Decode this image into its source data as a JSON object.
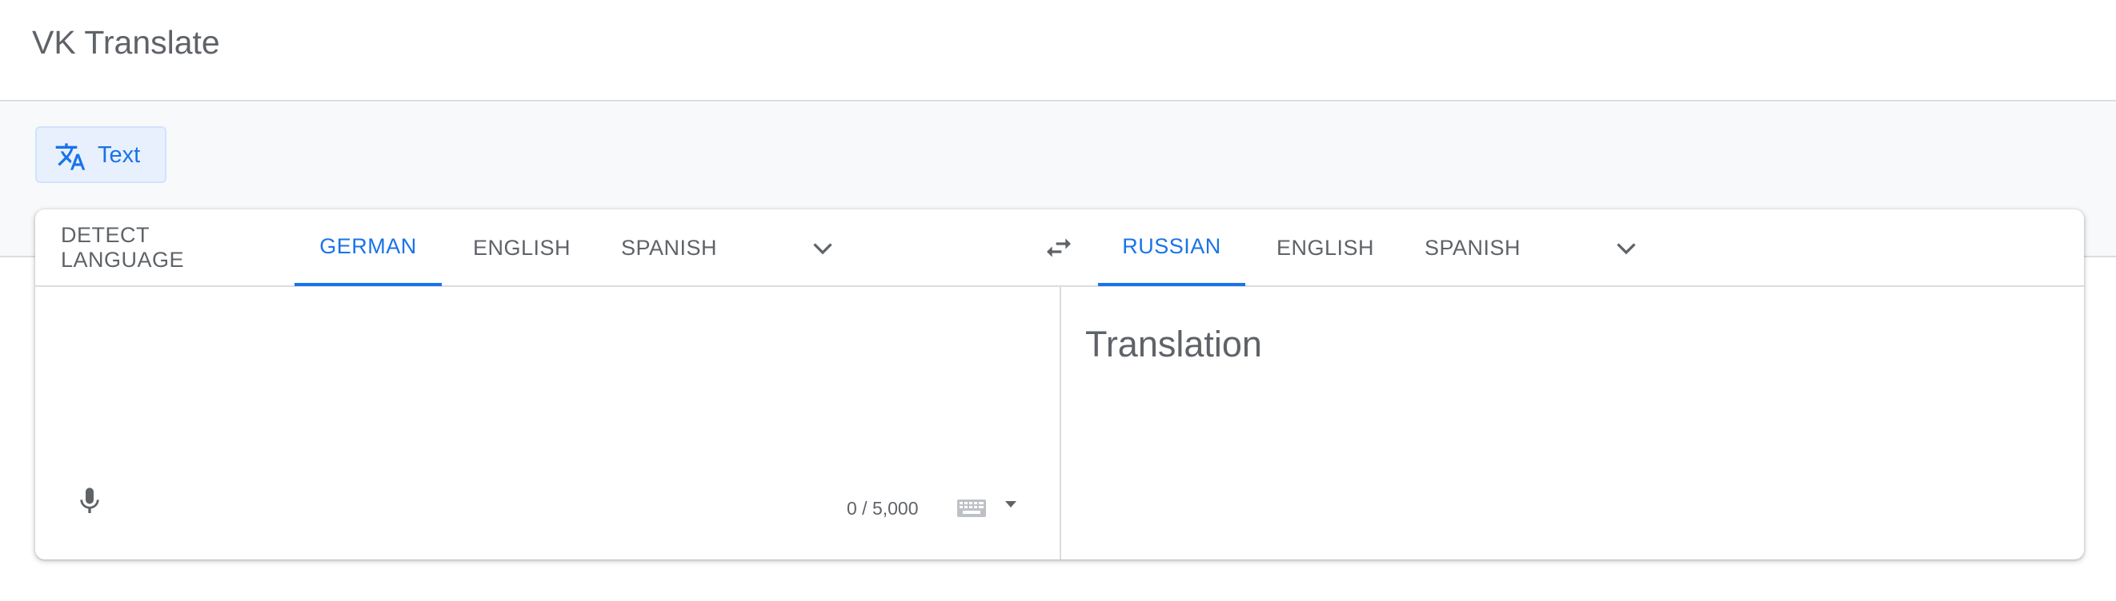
{
  "app": {
    "title": "VK Translate"
  },
  "mode": {
    "text_label": "Text",
    "icon": "translate-icon"
  },
  "source": {
    "tabs": [
      {
        "label": "DETECT LANGUAGE",
        "active": false
      },
      {
        "label": "GERMAN",
        "active": true
      },
      {
        "label": "ENGLISH",
        "active": false
      },
      {
        "label": "SPANISH",
        "active": false
      }
    ],
    "input_value": "",
    "char_count": "0 / 5,000"
  },
  "target": {
    "tabs": [
      {
        "label": "RUSSIAN",
        "active": true
      },
      {
        "label": "ENGLISH",
        "active": false
      },
      {
        "label": "SPANISH",
        "active": false
      }
    ],
    "placeholder": "Translation"
  },
  "colors": {
    "accent": "#1a73e8",
    "text": "#5f6368",
    "divider": "#dadce0",
    "band": "#f8f9fa"
  }
}
